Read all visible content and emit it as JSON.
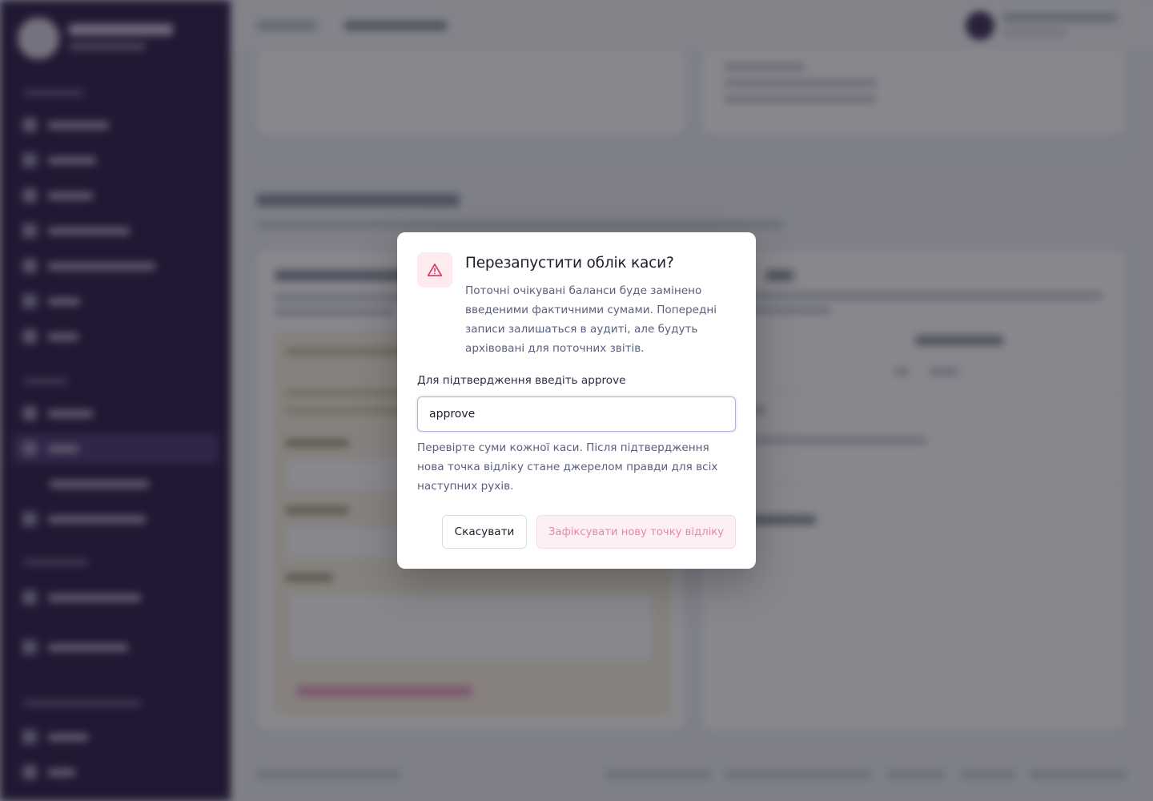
{
  "dialog": {
    "icon": "warning-triangle-icon",
    "title": "Перезапустити облік каси?",
    "description": "Поточні очікувані баланси буде замінено введеними фактичними сумами. Попередні записи залишаться в аудиті, але будуть архівовані для поточних звітів.",
    "confirm_label": "Для підтвердження введіть approve",
    "input_value": "approve",
    "help_text": "Перевірте суми кожної каси. Після підтвердження нова точка відліку стане джерелом правди для всіх наступних рухів.",
    "cancel_button": "Скасувати",
    "confirm_button": "Зафіксувати нову точку відліку"
  },
  "colors": {
    "sidebar": "#2a1a45",
    "overlay": "rgba(24,24,34,0.52)",
    "danger_accent": "#e58aa6",
    "danger_icon": "#d8395f",
    "input_border": "#b7afd6"
  }
}
